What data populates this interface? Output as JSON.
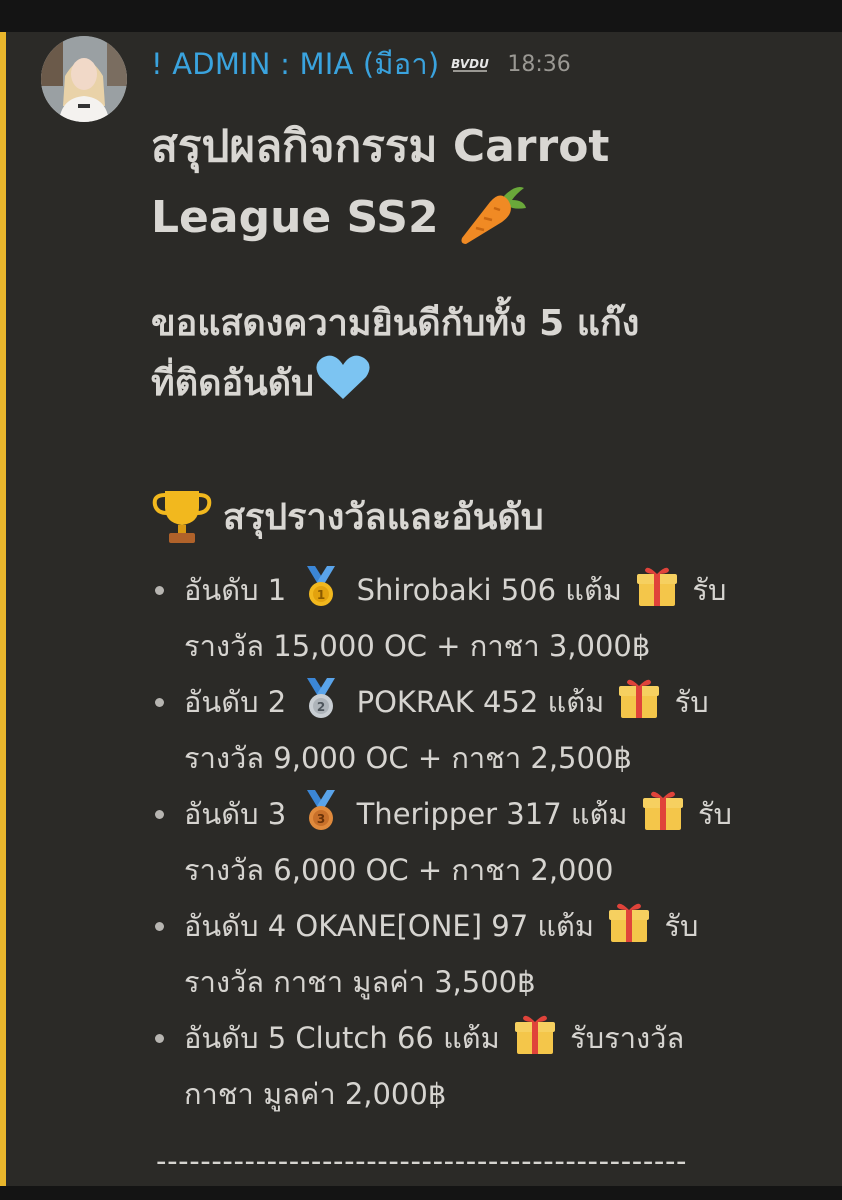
{
  "message": {
    "author": "! ADMIN : MIA (มีอา)",
    "author_tag_badge": "BVDU",
    "timestamp": "18:36",
    "title_line1": "สรุปผลกิจกรรม Carrot",
    "title_line2": "League SS2",
    "subtitle_line1": "ขอแสดงความยินดีกับทั้ง 5 แก๊ง",
    "subtitle_line2": "ที่ติดอันดับ",
    "section_heading": "สรุปรางวัลและอันดับ",
    "rankings": [
      {
        "line1_a": "อันดับ 1",
        "line1_b": "Shirobaki 506 แต้ม",
        "line1_c": "รับ",
        "line2": "รางวัล 15,000 OC + กาชา 3,000฿",
        "medal": "gold-medal-1"
      },
      {
        "line1_a": "อันดับ 2",
        "line1_b": "POKRAK 452 แต้ม",
        "line1_c": "รับ",
        "line2": "รางวัล 9,000 OC + กาชา 2,500฿",
        "medal": "silver-medal-2"
      },
      {
        "line1_a": "อันดับ 3",
        "line1_b": "Theripper 317 แต้ม",
        "line1_c": "รับ",
        "line2": "รางวัล 6,000 OC + กาชา 2,000",
        "medal": "bronze-medal-3"
      },
      {
        "line1_a": "อันดับ 4 OKANE[ONE] 97 แต้ม",
        "line1_c": "รับ",
        "line2": "รางวัล กาชา มูลค่า 3,500฿"
      },
      {
        "line1_a": "อันดับ 5  Clutch 66 แต้ม",
        "line1_c": "รับรางวัล",
        "line2": "กาชา มูลค่า 2,000฿"
      }
    ],
    "divider": "------------------------------------------------"
  },
  "colors": {
    "background": "#2b2a27",
    "mention_bar": "#e9b62c",
    "username": "#3aa3de",
    "text": "#d9d7d3",
    "timestamp": "#9a9893"
  },
  "icons": [
    "carrot-icon",
    "blue-heart-icon",
    "trophy-icon",
    "gift-icon",
    "gold-medal-icon",
    "silver-medal-icon",
    "bronze-medal-icon"
  ]
}
